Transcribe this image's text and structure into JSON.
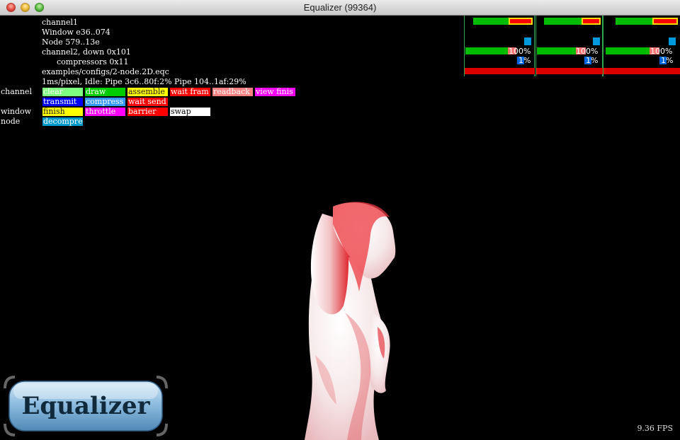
{
  "window": {
    "title": "Equalizer (99364)"
  },
  "stats": {
    "lines": [
      "channel1",
      "Window e36..074",
      "Node 579..13e",
      "channel2, down 0x101",
      "compressors 0x11",
      "examples/configs/2-node.2D.eqc",
      "1ms/pixel, Idle: Pipe 3c6..80f:2% Pipe 104..1af:29%"
    ]
  },
  "legend": {
    "channel_label": "channel",
    "window_label": "window",
    "node_label": "node",
    "channel_row1": [
      "clear",
      "draw",
      "assemble",
      "wait fram",
      "readback",
      "view finis"
    ],
    "channel_row2": [
      "transmit",
      "compress",
      "wait send"
    ],
    "window_row": [
      "finish",
      "throttle",
      "barrier",
      "swap"
    ],
    "node_row": [
      "decompre"
    ]
  },
  "colors": {
    "clear": "#7fff7f",
    "draw": "#00cc00",
    "assemble": "#ffff00",
    "wait_frame": "#ff0000",
    "readback": "#ff8080",
    "view_finish": "#ff00ff",
    "transmit": "#0000ff",
    "compress": "#3399ff",
    "wait_send": "#ff0000",
    "finish": "#ffff00",
    "throttle": "#ff00ff",
    "barrier": "#ff0000",
    "swap": "#ffffff",
    "decompress": "#0099cc"
  },
  "panels": [
    {
      "percent_top": "100%",
      "percent_bottom": "1%"
    },
    {
      "percent_top": "100%",
      "percent_bottom": "1%"
    },
    {
      "percent_top": "100%",
      "percent_bottom": "1%"
    }
  ],
  "branding": {
    "logo_text": "Equalizer"
  },
  "status": {
    "fps": "9.36 FPS"
  }
}
